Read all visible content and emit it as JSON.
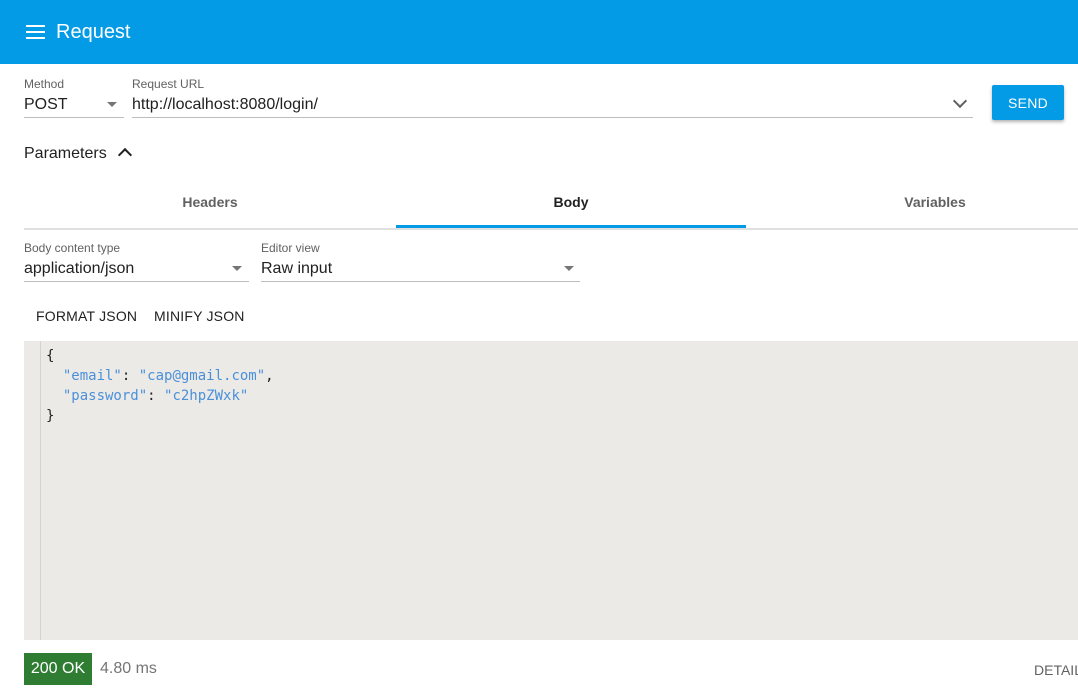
{
  "appbar": {
    "title": "Request",
    "menu_icon": "hamburger-menu-icon"
  },
  "request": {
    "method_label": "Method",
    "method_value": "POST",
    "url_label": "Request URL",
    "url_value": "http://localhost:8080/login/",
    "send_label": "SEND"
  },
  "parameters": {
    "label": "Parameters",
    "toggle_icon": "chevron-up-icon"
  },
  "tabs": [
    {
      "label": "Headers",
      "active": false
    },
    {
      "label": "Body",
      "active": true
    },
    {
      "label": "Variables",
      "active": false
    }
  ],
  "body": {
    "content_type_label": "Body content type",
    "content_type_value": "application/json",
    "editor_view_label": "Editor view",
    "editor_view_value": "Raw input",
    "format_json_label": "FORMAT JSON",
    "minify_json_label": "MINIFY JSON",
    "code": {
      "open_brace": "{",
      "key1": "\"email\"",
      "val1": "\"cap@gmail.com\"",
      "key2": "\"password\"",
      "val2": "\"c2hpZWxk\"",
      "close_brace": "}"
    }
  },
  "response": {
    "status": "200 OK",
    "time": "4.80 ms",
    "detail_label": "DETAIL"
  },
  "colors": {
    "primary": "#039be5",
    "status_ok": "#2e7d32",
    "editor_bg": "#eceae7"
  }
}
